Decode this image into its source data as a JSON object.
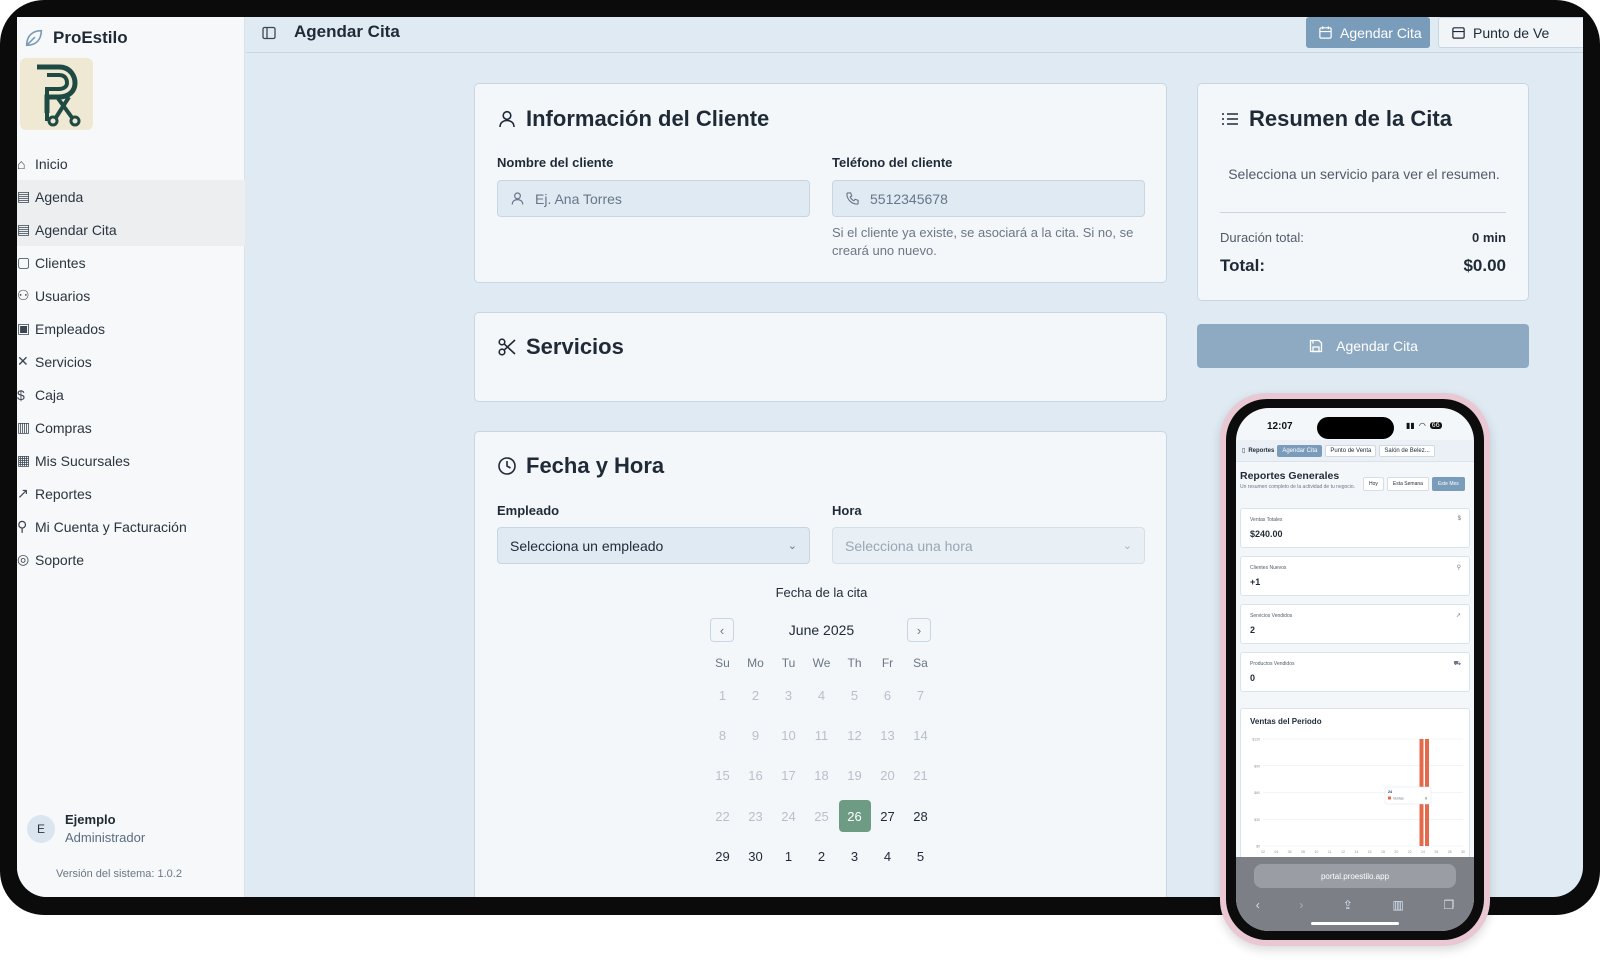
{
  "app": {
    "name": "ProEstilo"
  },
  "sidebar": {
    "items": [
      {
        "label": "Inicio",
        "active": false
      },
      {
        "label": "Agenda",
        "active": true
      },
      {
        "label": "Agendar Cita",
        "active": true
      },
      {
        "label": "Clientes",
        "active": false
      },
      {
        "label": "Usuarios",
        "active": false
      },
      {
        "label": "Empleados",
        "active": false
      },
      {
        "label": "Servicios",
        "active": false
      },
      {
        "label": "Caja",
        "active": false
      },
      {
        "label": "Compras",
        "active": false
      },
      {
        "label": "Mis Sucursales",
        "active": false
      },
      {
        "label": "Reportes",
        "active": false
      },
      {
        "label": "Mi Cuenta y Facturación",
        "active": false
      },
      {
        "label": "Soporte",
        "active": false
      }
    ],
    "user": {
      "initial": "E",
      "name": "Ejemplo",
      "role": "Administrador"
    },
    "version": "Versión del sistema: 1.0.2"
  },
  "header": {
    "title": "Agendar Cita",
    "tabs": [
      {
        "label": "Agendar Cita",
        "active": true
      },
      {
        "label": "Punto de Ve",
        "active": false
      }
    ]
  },
  "cliente": {
    "title": "Información del Cliente",
    "name_label": "Nombre del cliente",
    "name_placeholder": "Ej. Ana Torres",
    "phone_label": "Teléfono del cliente",
    "phone_placeholder": "5512345678",
    "hint_line1": "Si el cliente ya existe, se asociará a la cita. Si no, se",
    "hint_line2": "creará uno nuevo."
  },
  "servicios": {
    "title": "Servicios"
  },
  "fecha": {
    "title": "Fecha y Hora",
    "empleado_label": "Empleado",
    "empleado_value": "Selecciona un empleado",
    "hora_label": "Hora",
    "hora_value": "Selecciona una hora",
    "calendar_label": "Fecha de la cita",
    "month": "June 2025",
    "weekdays": [
      "Su",
      "Mo",
      "Tu",
      "We",
      "Th",
      "Fr",
      "Sa"
    ],
    "days": [
      {
        "d": "1",
        "on": false
      },
      {
        "d": "2",
        "on": false
      },
      {
        "d": "3",
        "on": false
      },
      {
        "d": "4",
        "on": false
      },
      {
        "d": "5",
        "on": false
      },
      {
        "d": "6",
        "on": false
      },
      {
        "d": "7",
        "on": false
      },
      {
        "d": "8",
        "on": false
      },
      {
        "d": "9",
        "on": false
      },
      {
        "d": "10",
        "on": false
      },
      {
        "d": "11",
        "on": false
      },
      {
        "d": "12",
        "on": false
      },
      {
        "d": "13",
        "on": false
      },
      {
        "d": "14",
        "on": false
      },
      {
        "d": "15",
        "on": false
      },
      {
        "d": "16",
        "on": false
      },
      {
        "d": "17",
        "on": false
      },
      {
        "d": "18",
        "on": false
      },
      {
        "d": "19",
        "on": false
      },
      {
        "d": "20",
        "on": false
      },
      {
        "d": "21",
        "on": false
      },
      {
        "d": "22",
        "on": false
      },
      {
        "d": "23",
        "on": false
      },
      {
        "d": "24",
        "on": false
      },
      {
        "d": "25",
        "on": false
      },
      {
        "d": "26",
        "on": true,
        "selected": true
      },
      {
        "d": "27",
        "on": true
      },
      {
        "d": "28",
        "on": true
      },
      {
        "d": "29",
        "on": true
      },
      {
        "d": "30",
        "on": true
      },
      {
        "d": "1",
        "on": true
      },
      {
        "d": "2",
        "on": true
      },
      {
        "d": "3",
        "on": true
      },
      {
        "d": "4",
        "on": true
      },
      {
        "d": "5",
        "on": true
      }
    ]
  },
  "resumen": {
    "title": "Resumen de la Cita",
    "empty": "Selecciona un servicio para ver el resumen.",
    "duracion_label": "Duración total:",
    "duracion_value": "0 min",
    "total_label": "Total:",
    "total_value": "$0.00",
    "button": "Agendar Cita"
  },
  "phone": {
    "time": "12:07",
    "battery": "66",
    "tabs": [
      "Reportes",
      "Agendar Cita",
      "Punto de Venta",
      "Salón de Belez..."
    ],
    "title": "Reportes Generales",
    "subtitle": "Un resumen completo de la actividad de tu negocio.",
    "filters": [
      {
        "label": "Hoy",
        "active": false
      },
      {
        "label": "Esta Semana",
        "active": false
      },
      {
        "label": "Este Mes",
        "active": true
      }
    ],
    "kpis": [
      {
        "label": "Ventas Totales",
        "value": "$240.00",
        "icon": "$"
      },
      {
        "label": "Clientes Nuevos",
        "value": "+1",
        "icon": "user-icon"
      },
      {
        "label": "Servicios Vendidos",
        "value": "2",
        "icon": "trend-icon"
      },
      {
        "label": "Productos Vendidos",
        "value": "0",
        "icon": "cart-icon"
      }
    ],
    "chart_title": "Ventas del Periodo",
    "url": "portal.proestilo.app",
    "colors": {
      "bar": "#e46a4b"
    }
  },
  "chart_data": {
    "type": "bar",
    "title": "Ventas del Periodo",
    "y_ticks": [
      "$0",
      "$30",
      "$60",
      "$90",
      "$120"
    ],
    "x_ticks": [
      "02",
      "04",
      "06",
      "08",
      "10",
      "11",
      "12",
      "14",
      "16",
      "18",
      "20",
      "22",
      "24",
      "26",
      "28",
      "30"
    ],
    "series": [
      {
        "name": "Ventas",
        "x": [
          "24"
        ],
        "values": [
          120
        ]
      }
    ],
    "tooltip": {
      "label": "24",
      "series": "Ventas",
      "value": "0"
    },
    "ylim": [
      0,
      120
    ]
  }
}
